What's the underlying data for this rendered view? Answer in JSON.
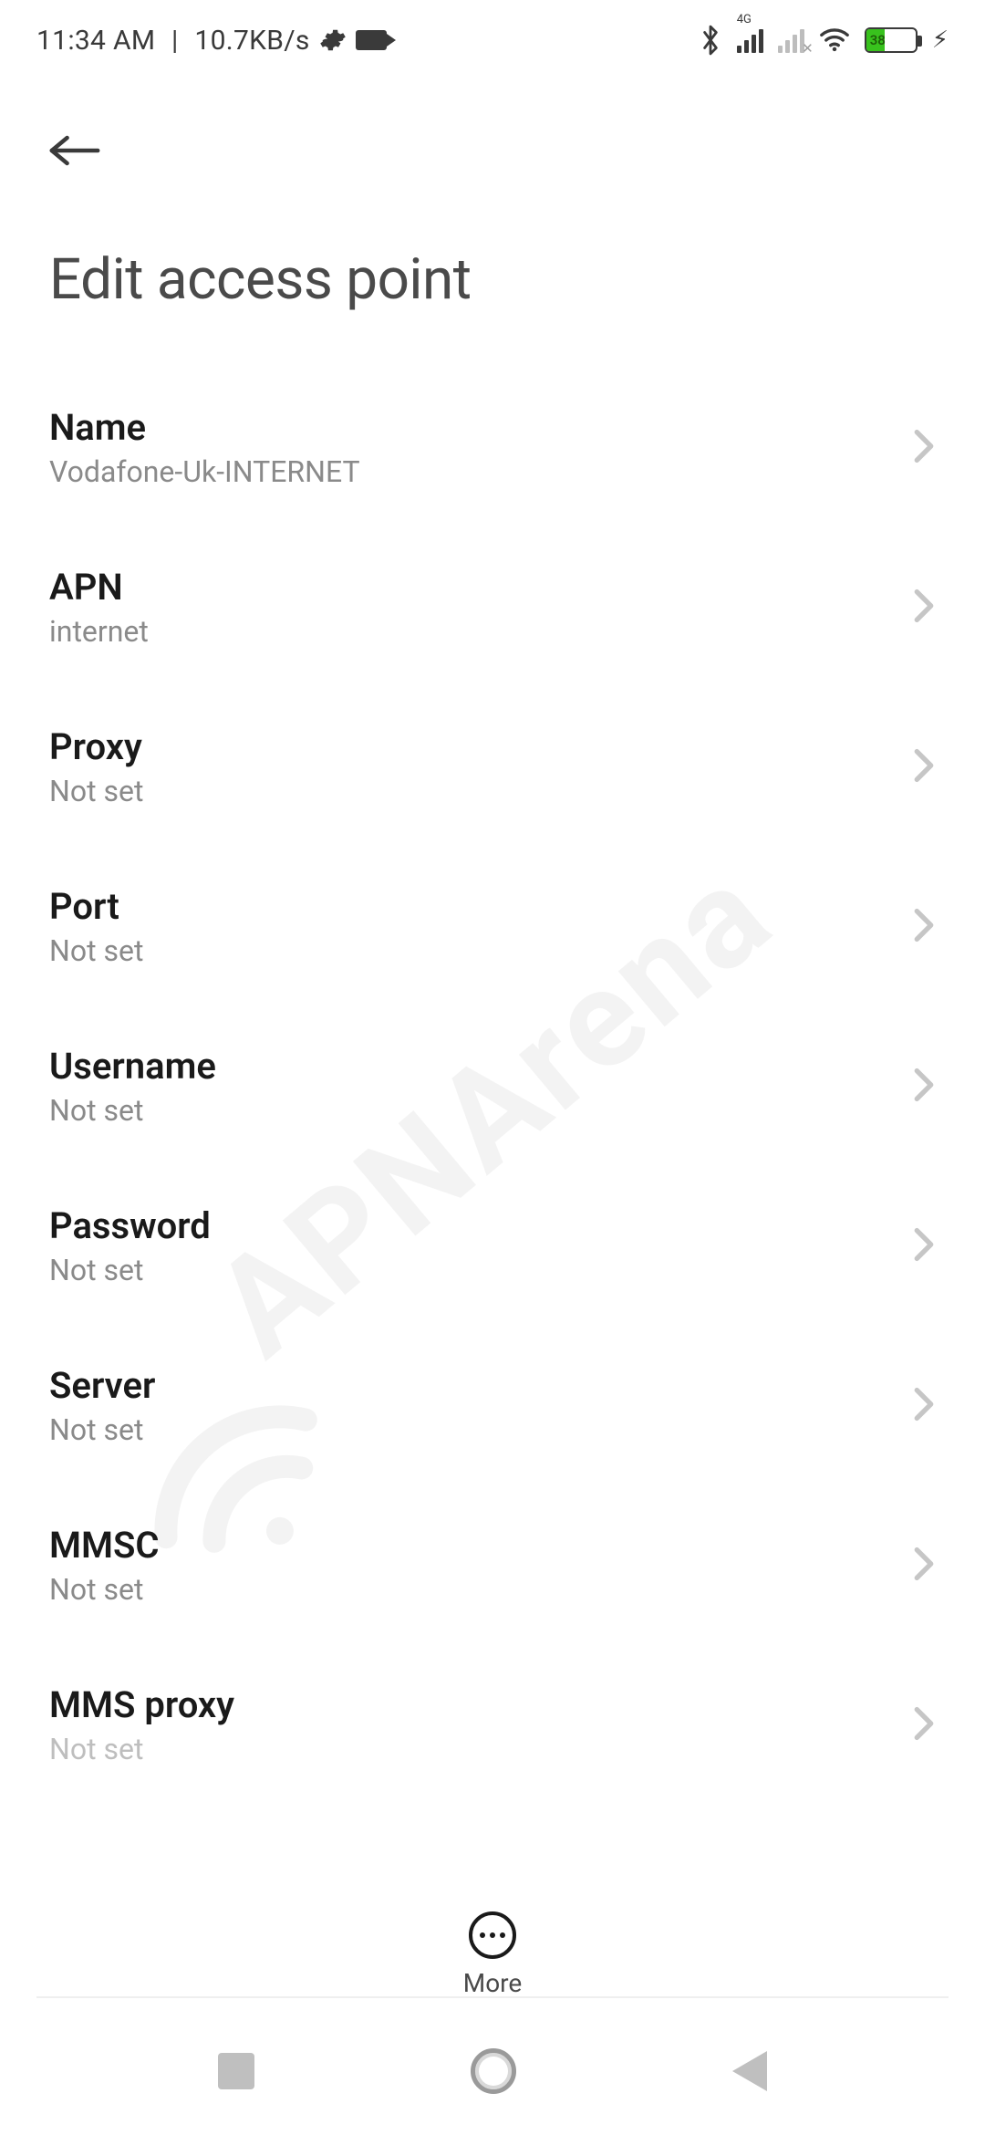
{
  "status": {
    "time": "11:34 AM",
    "net_speed": "10.7KB/s",
    "net_tag_sim1": "4G",
    "battery_pct": "38"
  },
  "header": {
    "title": "Edit access point"
  },
  "rows": [
    {
      "label": "Name",
      "value": "Vodafone-Uk-INTERNET"
    },
    {
      "label": "APN",
      "value": "internet"
    },
    {
      "label": "Proxy",
      "value": "Not set"
    },
    {
      "label": "Port",
      "value": "Not set"
    },
    {
      "label": "Username",
      "value": "Not set"
    },
    {
      "label": "Password",
      "value": "Not set"
    },
    {
      "label": "Server",
      "value": "Not set"
    },
    {
      "label": "MMSC",
      "value": "Not set"
    },
    {
      "label": "MMS proxy",
      "value": "Not set"
    }
  ],
  "action": {
    "more_label": "More"
  },
  "watermark": "APNArena"
}
